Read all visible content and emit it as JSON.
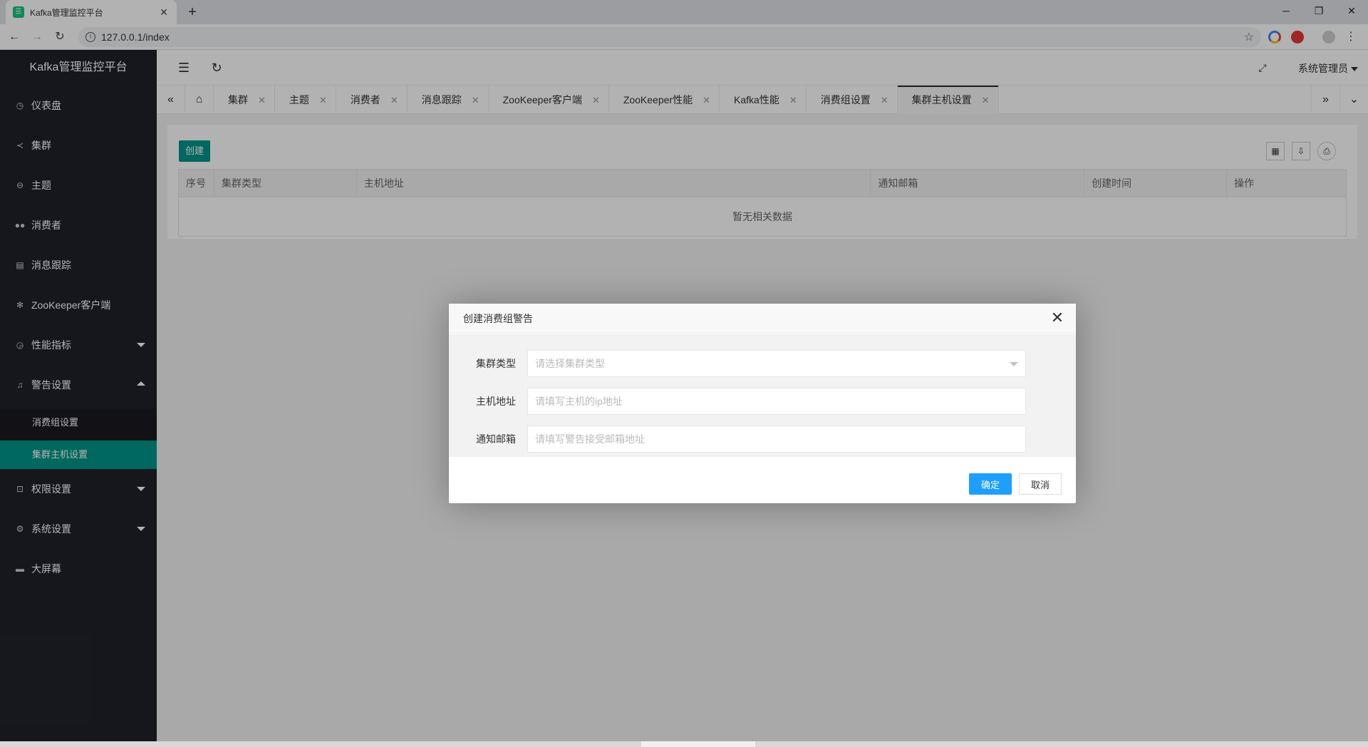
{
  "browser": {
    "tab_title": "Kafka管理监控平台",
    "url": "127.0.0.1/index"
  },
  "app": {
    "logo": "Kafka管理监控平台",
    "admin": "系统管理员"
  },
  "sidebar": {
    "items": [
      {
        "label": "仪表盘",
        "icon": "dashboard-icon"
      },
      {
        "label": "集群",
        "icon": "share-icon"
      },
      {
        "label": "主题",
        "icon": "topic-icon"
      },
      {
        "label": "消费者",
        "icon": "users-icon"
      },
      {
        "label": "消息跟踪",
        "icon": "file-icon"
      },
      {
        "label": "ZooKeeper客户端",
        "icon": "zookeeper-icon"
      },
      {
        "label": "性能指标",
        "icon": "gauge-icon"
      },
      {
        "label": "警告设置",
        "icon": "bell-icon"
      },
      {
        "label": "权限设置",
        "icon": "lock-icon"
      },
      {
        "label": "系统设置",
        "icon": "gear-icon"
      },
      {
        "label": "大屏幕",
        "icon": "monitor-icon"
      }
    ],
    "sub_items": [
      {
        "label": "消费组设置"
      },
      {
        "label": "集群主机设置"
      }
    ]
  },
  "page_tabs": [
    {
      "label": "集群"
    },
    {
      "label": "主题"
    },
    {
      "label": "消费者"
    },
    {
      "label": "消息跟踪"
    },
    {
      "label": "ZooKeeper客户端"
    },
    {
      "label": "ZooKeeper性能"
    },
    {
      "label": "Kafka性能"
    },
    {
      "label": "消费组设置"
    },
    {
      "label": "集群主机设置"
    }
  ],
  "main": {
    "create_label": "创建",
    "table": {
      "headers": [
        "序号",
        "集群类型",
        "主机地址",
        "通知邮箱",
        "创建时间",
        "操作"
      ],
      "empty_text": "暂无相关数据"
    }
  },
  "dialog": {
    "title": "创建消费组警告",
    "fields": {
      "cluster_type": {
        "label": "集群类型",
        "placeholder": "请选择集群类型"
      },
      "host": {
        "label": "主机地址",
        "placeholder": "请填写主机的ip地址"
      },
      "email": {
        "label": "通知邮箱",
        "placeholder": "请填写警告接受邮箱地址"
      }
    },
    "ok_label": "确定",
    "cancel_label": "取消"
  },
  "colors": {
    "sidebar_bg": "#20222a",
    "accent_green": "#009688",
    "primary_blue": "#1e9fff"
  }
}
